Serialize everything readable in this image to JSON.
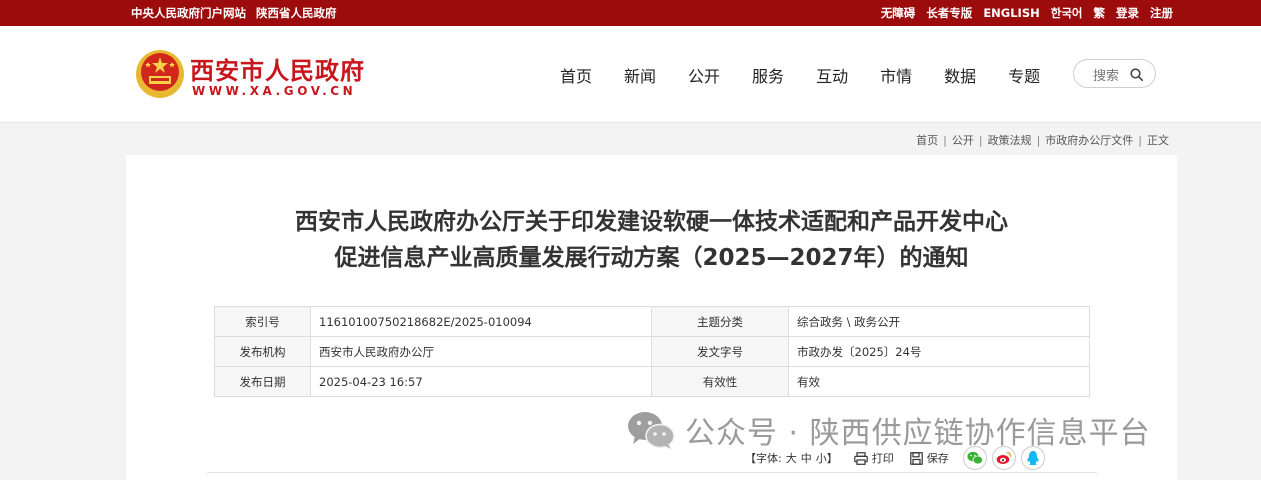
{
  "topbar": {
    "left_links": [
      "中央人民政府门户网站",
      "陕西省人民政府"
    ],
    "right_links": [
      "无障碍",
      "长者专版",
      "ENGLISH",
      "한국어",
      "繁",
      "登录",
      "注册"
    ]
  },
  "header": {
    "site_name": "西安市人民政府",
    "site_url": "WWW.XA.GOV.CN",
    "nav": [
      "首页",
      "新闻",
      "公开",
      "服务",
      "互动",
      "市情",
      "数据",
      "专题"
    ],
    "search_label": "搜索"
  },
  "breadcrumb": [
    "首页",
    "公开",
    "政策法规",
    "市政府办公厅文件",
    "正文"
  ],
  "article": {
    "title_line1": "西安市人民政府办公厅关于印发建设软硬一体技术适配和产品开发中心",
    "title_line2": "促进信息产业高质量发展行动方案（2025—2027年）的通知"
  },
  "meta": {
    "rows": [
      {
        "k1": "索引号",
        "v1": "11610100750218682E/2025-010094",
        "k2": "主题分类",
        "v2": "综合政务 \\ 政务公开"
      },
      {
        "k1": "发布机构",
        "v1": "西安市人民政府办公厅",
        "k2": "发文字号",
        "v2": "市政办发〔2025〕24号"
      },
      {
        "k1": "发布日期",
        "v1": "2025-04-23 16:57",
        "k2": "有效性",
        "v2": "有效"
      }
    ]
  },
  "watermark": {
    "text": "公众号 · 陕西供应链协作信息平台"
  },
  "tools": {
    "font_label": "【字体:",
    "font_sizes": [
      "大",
      "中",
      "小"
    ],
    "font_close": "】",
    "print_label": "打印",
    "save_label": "保存",
    "share_icons": [
      "wechat-icon",
      "weibo-icon",
      "qq-icon"
    ]
  },
  "colors": {
    "brand_red": "#9c0c0c",
    "logo_red": "#c8161d"
  }
}
